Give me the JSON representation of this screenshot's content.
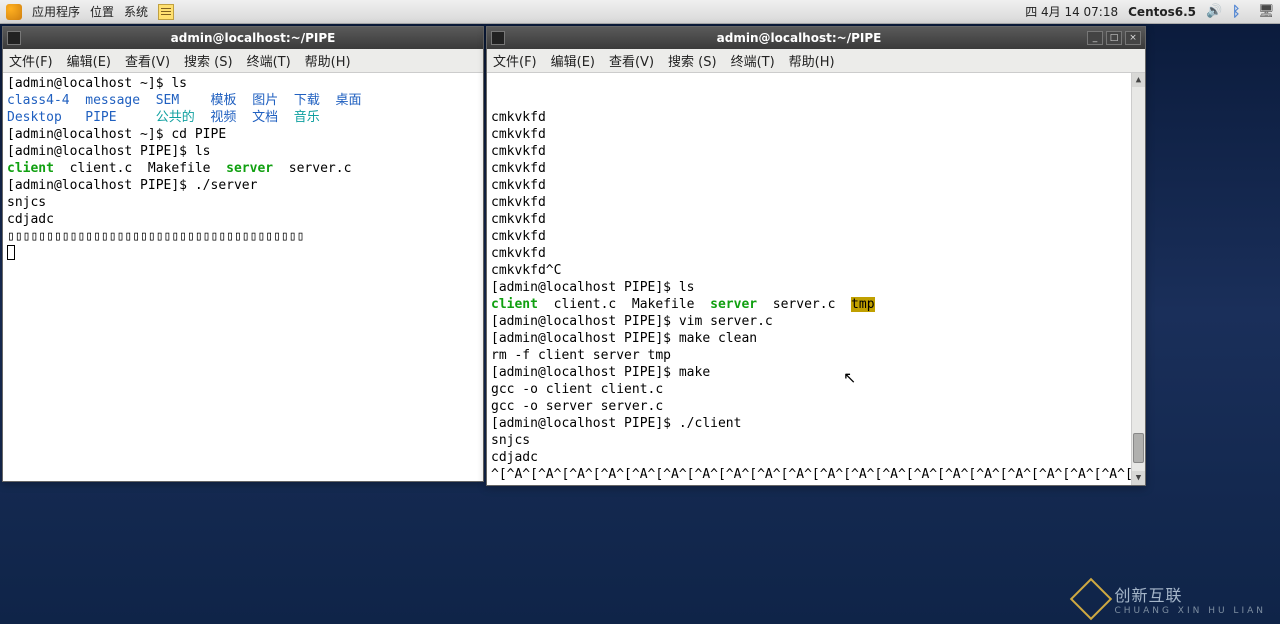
{
  "taskbar": {
    "menu_apps": "应用程序",
    "menu_places": "位置",
    "menu_system": "系统",
    "date": "四 4月 14 07:18",
    "hostname": "Centos6.5"
  },
  "win1": {
    "title": "admin@localhost:~/PIPE",
    "menus": [
      "文件(F)",
      "编辑(E)",
      "查看(V)",
      "搜索 (S)",
      "终端(T)",
      "帮助(H)"
    ],
    "lines": [
      {
        "t": "[admin@localhost ~]$ ls"
      },
      {
        "segs": [
          {
            "c": "c-blue",
            "t": "class4-4"
          },
          {
            "t": "  "
          },
          {
            "c": "c-blue",
            "t": "message"
          },
          {
            "t": "  "
          },
          {
            "c": "c-blue",
            "t": "SEM"
          },
          {
            "t": "    "
          },
          {
            "c": "c-blue",
            "t": "模板"
          },
          {
            "t": "  "
          },
          {
            "c": "c-blue",
            "t": "图片"
          },
          {
            "t": "  "
          },
          {
            "c": "c-blue",
            "t": "下载"
          },
          {
            "t": "  "
          },
          {
            "c": "c-blue",
            "t": "桌面"
          }
        ]
      },
      {
        "segs": [
          {
            "c": "c-blue",
            "t": "Desktop"
          },
          {
            "t": "   "
          },
          {
            "c": "c-blue",
            "t": "PIPE"
          },
          {
            "t": "     "
          },
          {
            "c": "c-teal",
            "t": "公共的"
          },
          {
            "t": "  "
          },
          {
            "c": "c-blue",
            "t": "视频"
          },
          {
            "t": "  "
          },
          {
            "c": "c-blue",
            "t": "文档"
          },
          {
            "t": "  "
          },
          {
            "c": "c-teal",
            "t": "音乐"
          }
        ]
      },
      {
        "t": "[admin@localhost ~]$ cd PIPE"
      },
      {
        "t": "[admin@localhost PIPE]$ ls"
      },
      {
        "segs": [
          {
            "c": "c-green",
            "t": "client"
          },
          {
            "t": "  client.c  Makefile  "
          },
          {
            "c": "c-green",
            "t": "server"
          },
          {
            "t": "  server.c"
          }
        ]
      },
      {
        "t": "[admin@localhost PIPE]$ ./server"
      },
      {
        "t": "snjcs"
      },
      {
        "t": "cdjadc"
      },
      {
        "t": "▯▯▯▯▯▯▯▯▯▯▯▯▯▯▯▯▯▯▯▯▯▯▯▯▯▯▯▯▯▯▯▯▯▯▯▯▯▯"
      }
    ]
  },
  "win2": {
    "title": "admin@localhost:~/PIPE",
    "menus": [
      "文件(F)",
      "编辑(E)",
      "查看(V)",
      "搜索 (S)",
      "终端(T)",
      "帮助(H)"
    ],
    "lines": [
      {
        "t": "cmkvkfd"
      },
      {
        "t": "cmkvkfd"
      },
      {
        "t": "cmkvkfd"
      },
      {
        "t": "cmkvkfd"
      },
      {
        "t": "cmkvkfd"
      },
      {
        "t": "cmkvkfd"
      },
      {
        "t": "cmkvkfd"
      },
      {
        "t": "cmkvkfd"
      },
      {
        "t": "cmkvkfd"
      },
      {
        "t": "cmkvkfd^C"
      },
      {
        "t": "[admin@localhost PIPE]$ ls"
      },
      {
        "segs": [
          {
            "c": "c-green",
            "t": "client"
          },
          {
            "t": "  client.c  Makefile  "
          },
          {
            "c": "c-green",
            "t": "server"
          },
          {
            "t": "  server.c  "
          },
          {
            "c": "c-hl",
            "t": "tmp"
          }
        ]
      },
      {
        "t": "[admin@localhost PIPE]$ vim server.c"
      },
      {
        "t": "[admin@localhost PIPE]$ make clean"
      },
      {
        "t": "rm -f client server tmp"
      },
      {
        "t": "[admin@localhost PIPE]$ make"
      },
      {
        "t": "gcc -o client client.c"
      },
      {
        "t": "gcc -o server server.c"
      },
      {
        "t": "[admin@localhost PIPE]$ ./client"
      },
      {
        "t": "snjcs"
      },
      {
        "t": "cdjadc"
      },
      {
        "t": "^[^A^[^A^[^A^[^A^[^A^[^A^[^A^[^A^[^A^[^A^[^A^[^A^[^A^[^A^[^A^[^A^[^A^[^A^[^A^[^A^[^A"
      }
    ]
  },
  "watermark": {
    "main": "创新互联",
    "sub": "CHUANG XIN HU LIAN"
  }
}
